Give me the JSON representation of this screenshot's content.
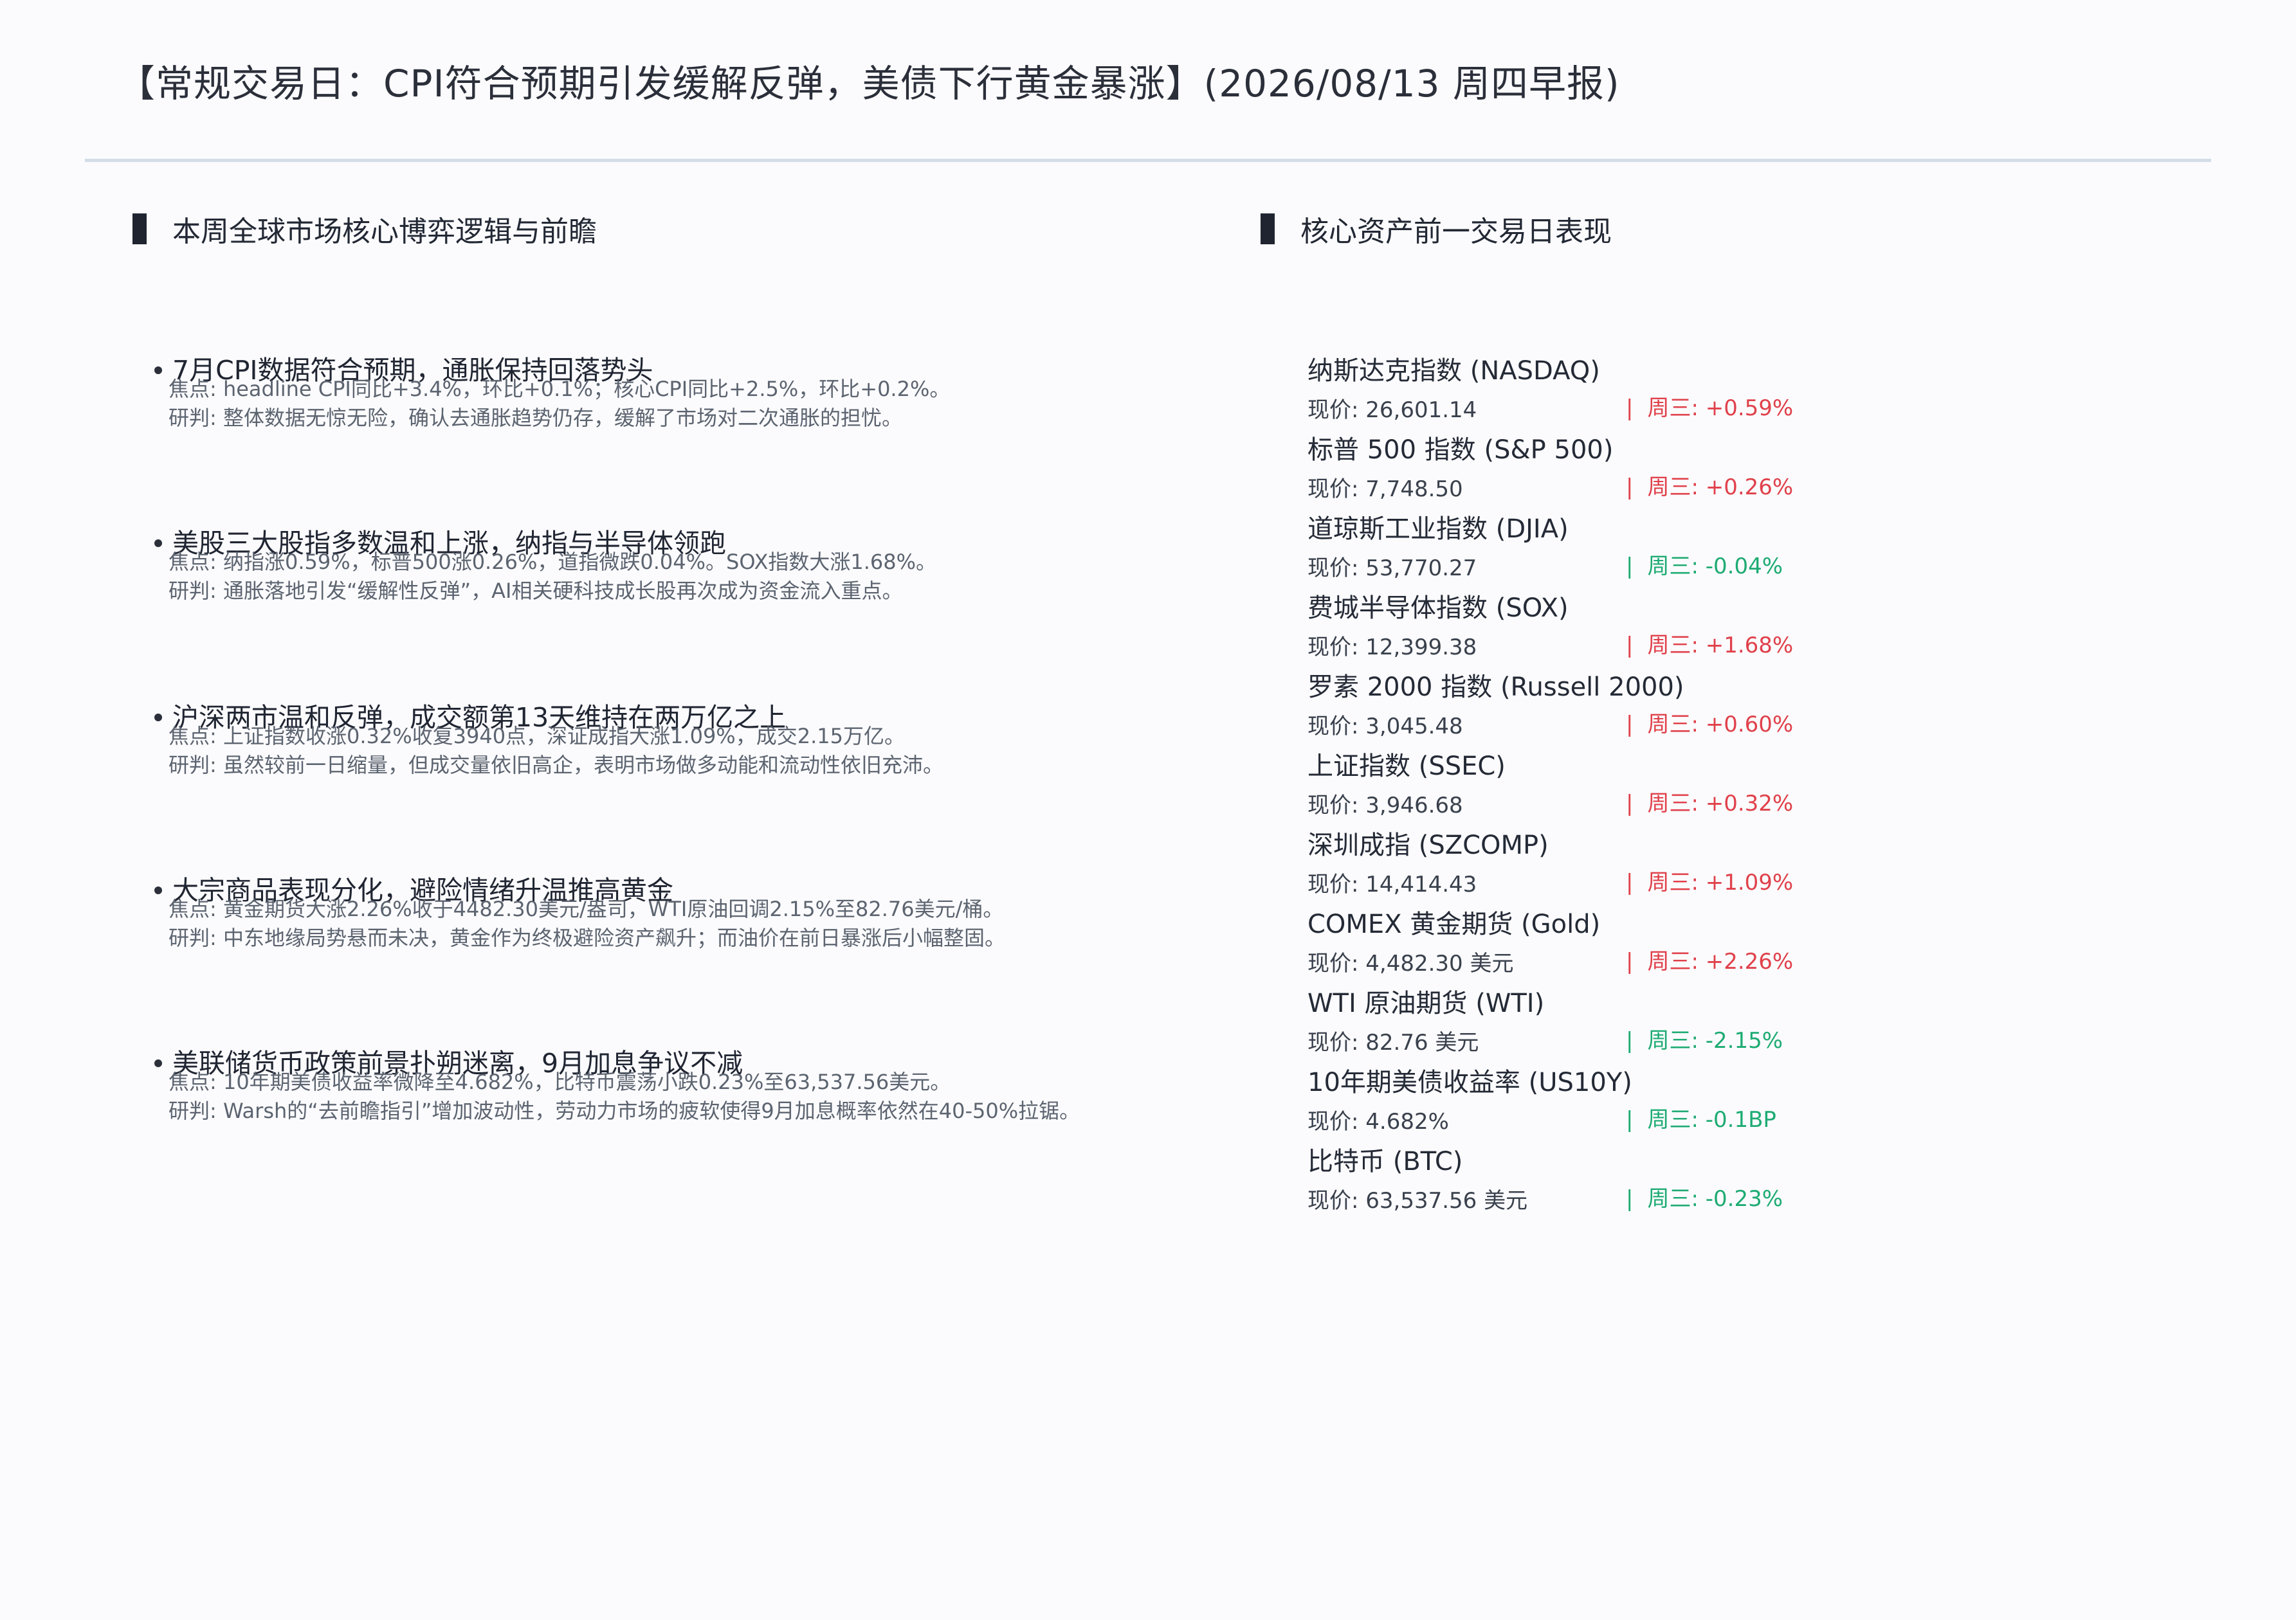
{
  "page": {
    "title": "【常规交易日：CPI符合预期引发缓解反弹，美债下行黄金暴涨】(2026/08/13 周四早报)"
  },
  "left_section": {
    "heading": "本周全球市场核心博弈逻辑与前瞻",
    "topics": [
      {
        "headline": "7月CPI数据符合预期，通胀保持回落势头",
        "focus": "焦点: headline CPI同比+3.4%，环比+0.1%；核心CPI同比+2.5%，环比+0.2%。",
        "judgement": "研判: 整体数据无惊无险，确认去通胀趋势仍存，缓解了市场对二次通胀的担忧。"
      },
      {
        "headline": "美股三大股指多数温和上涨，纳指与半导体领跑",
        "focus": "焦点: 纳指涨0.59%，标普500涨0.26%，道指微跌0.04%。SOX指数大涨1.68%。",
        "judgement": "研判: 通胀落地引发“缓解性反弹”，AI相关硬科技成长股再次成为资金流入重点。"
      },
      {
        "headline": "沪深两市温和反弹，成交额第13天维持在两万亿之上",
        "focus": "焦点: 上证指数收涨0.32%收复3940点，深证成指大涨1.09%，成交2.15万亿。",
        "judgement": "研判: 虽然较前一日缩量，但成交量依旧高企，表明市场做多动能和流动性依旧充沛。"
      },
      {
        "headline": "大宗商品表现分化，避险情绪升温推高黄金",
        "focus": "焦点: 黄金期货大涨2.26%收于4482.30美元/盎司，WTI原油回调2.15%至82.76美元/桶。",
        "judgement": "研判: 中东地缘局势悬而未决，黄金作为终极避险资产飙升；而油价在前日暴涨后小幅整固。"
      },
      {
        "headline": "美联储货币政策前景扑朔迷离，9月加息争议不减",
        "focus": "焦点: 10年期美债收益率微降至4.682%，比特币震荡小跌0.23%至63,537.56美元。",
        "judgement": "研判: Warsh的“去前瞻指引”增加波动性，劳动力市场的疲软使得9月加息概率依然在40-50%拉锯。"
      }
    ]
  },
  "right_section": {
    "heading": "核心资产前一交易日表现",
    "separator": "|",
    "assets": [
      {
        "name": "纳斯达克指数 (NASDAQ)",
        "price": "现价: 26,601.14",
        "change": "周三: +0.59%",
        "direction": "up"
      },
      {
        "name": "标普 500 指数 (S&P 500)",
        "price": "现价: 7,748.50",
        "change": "周三: +0.26%",
        "direction": "up"
      },
      {
        "name": "道琼斯工业指数 (DJIA)",
        "price": "现价: 53,770.27",
        "change": "周三: -0.04%",
        "direction": "down"
      },
      {
        "name": "费城半导体指数 (SOX)",
        "price": "现价: 12,399.38",
        "change": "周三: +1.68%",
        "direction": "up"
      },
      {
        "name": "罗素 2000 指数 (Russell 2000)",
        "price": "现价: 3,045.48",
        "change": "周三: +0.60%",
        "direction": "up"
      },
      {
        "name": "上证指数 (SSEC)",
        "price": "现价: 3,946.68",
        "change": "周三: +0.32%",
        "direction": "up"
      },
      {
        "name": "深圳成指 (SZCOMP)",
        "price": "现价: 14,414.43",
        "change": "周三: +1.09%",
        "direction": "up"
      },
      {
        "name": "COMEX 黄金期货 (Gold)",
        "price": "现价: 4,482.30 美元",
        "change": "周三: +2.26%",
        "direction": "up"
      },
      {
        "name": "WTI 原油期货 (WTI)",
        "price": "现价: 82.76 美元",
        "change": "周三: -2.15%",
        "direction": "down"
      },
      {
        "name": "10年期美债收益率 (US10Y)",
        "price": "现价: 4.682%",
        "change": "周三: -0.1BP",
        "direction": "down"
      },
      {
        "name": "比特币 (BTC)",
        "price": "现价: 63,537.56 美元",
        "change": "周三: -0.23%",
        "direction": "down"
      }
    ]
  },
  "colors": {
    "up": "#e0414b",
    "down": "#1eab73",
    "rule": "#d3dde8"
  }
}
